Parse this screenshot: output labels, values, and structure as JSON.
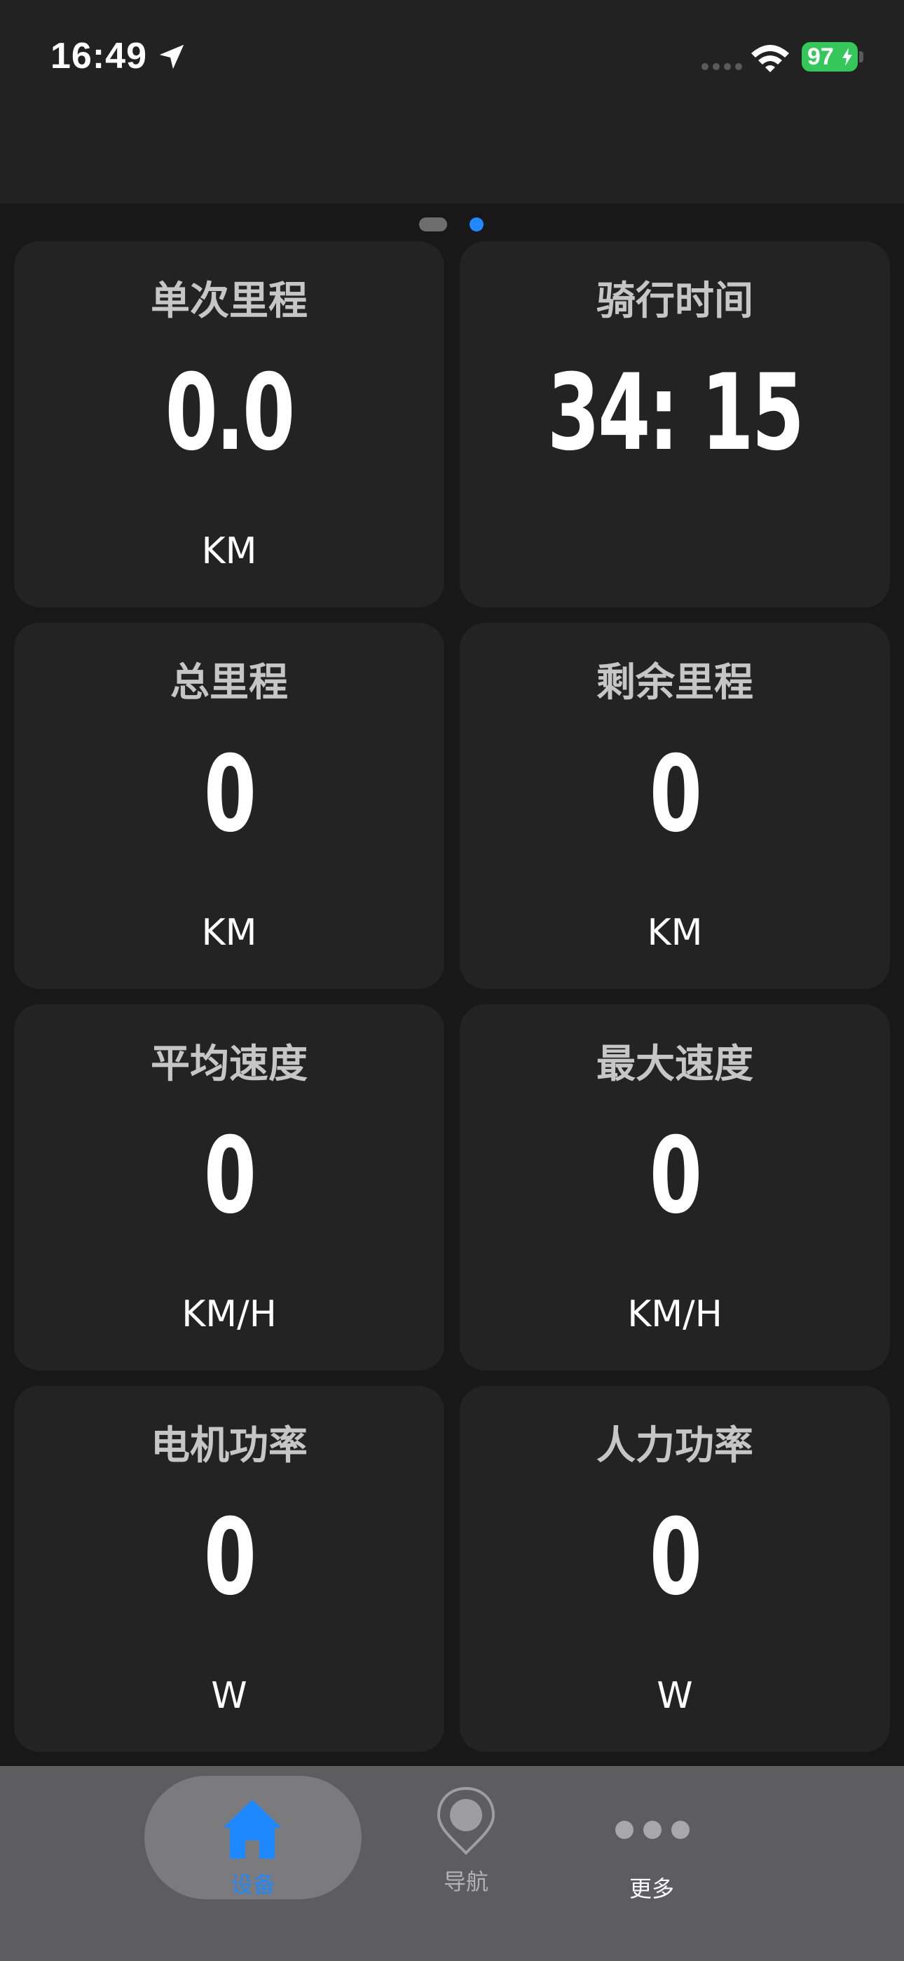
{
  "status_bar": {
    "time": "16:49",
    "battery_level": "97",
    "icons": [
      "location-arrow-icon",
      "cellular-signal-icon",
      "wifi-icon",
      "battery-charging-icon"
    ]
  },
  "pager": {
    "pages": 2,
    "active_page": 2
  },
  "cards": [
    {
      "title": "单次里程",
      "value": "0.0",
      "unit": "KM"
    },
    {
      "title": "骑行时间",
      "value": "34: 15",
      "unit": ""
    },
    {
      "title": "总里程",
      "value": "0",
      "unit": "KM"
    },
    {
      "title": "剩余里程",
      "value": "0",
      "unit": "KM"
    },
    {
      "title": "平均速度",
      "value": "0",
      "unit": "KM/H"
    },
    {
      "title": "最大速度",
      "value": "0",
      "unit": "KM/H"
    },
    {
      "title": "电机功率",
      "value": "0",
      "unit": "W"
    },
    {
      "title": "人力功率",
      "value": "0",
      "unit": "W"
    }
  ],
  "tabs": {
    "home": {
      "label": "设备",
      "icon": "home-icon",
      "active": true
    },
    "navigation": {
      "label": "导航",
      "icon": "map-pin-icon"
    },
    "more": {
      "label": "更多",
      "icon": "more-dots-icon"
    }
  },
  "colors": {
    "accent": "#1e88ff",
    "background": "#181818",
    "card": "#232323",
    "battery": "#34c759",
    "tab_bar": "#5d5d5f"
  }
}
